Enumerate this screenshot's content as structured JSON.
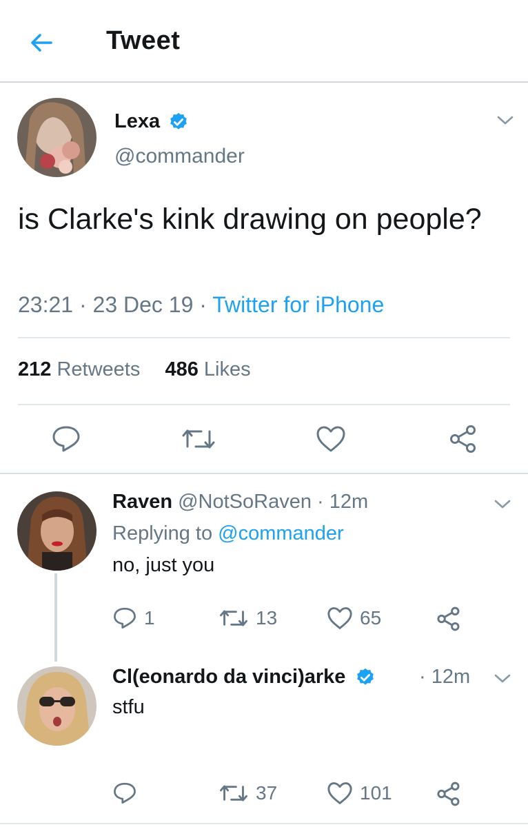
{
  "header": {
    "title": "Tweet"
  },
  "main_tweet": {
    "display_name": "Lexa",
    "handle": "@commander",
    "text": "is Clarke's kink drawing on people?",
    "time": "23:21",
    "date": "23 Dec 19",
    "separator": "·",
    "source": "Twitter for iPhone",
    "retweet_count": "212",
    "retweet_label": "Retweets",
    "like_count": "486",
    "like_label": "Likes"
  },
  "replies": [
    {
      "display_name": "Raven",
      "handle": "@NotSoRaven",
      "time": "· 12m",
      "replying_label": "Replying to",
      "replying_to": "@commander",
      "text": "no, just you",
      "reply_count": "1",
      "retweet_count": "13",
      "like_count": "65"
    },
    {
      "display_name": "Cl(eonardo da vinci)arke",
      "time": "· 12m",
      "text": "stfu",
      "retweet_count": "37",
      "like_count": "101"
    }
  ],
  "colors": {
    "accent": "#1da1f2",
    "muted": "#657786",
    "text": "#14171a",
    "divider": "#e1e8ed"
  },
  "icons": [
    "back-arrow-icon",
    "verified-badge-icon",
    "chevron-down-icon",
    "reply-icon",
    "retweet-icon",
    "like-icon",
    "share-icon"
  ]
}
